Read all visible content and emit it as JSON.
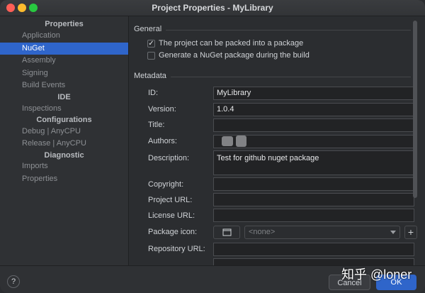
{
  "window": {
    "title": "Project Properties - MyLibrary"
  },
  "sidebar": {
    "sections": [
      {
        "heading": "Properties",
        "items": [
          "Application",
          "NuGet",
          "Assembly",
          "Signing",
          "Build Events"
        ]
      },
      {
        "heading": "IDE",
        "items": [
          "Inspections"
        ]
      },
      {
        "heading": "Configurations",
        "items": [
          "Debug | AnyCPU",
          "Release | AnyCPU"
        ]
      },
      {
        "heading": "Diagnostic",
        "items": [
          "Imports",
          "Properties"
        ]
      }
    ],
    "selected": "NuGet"
  },
  "general": {
    "title": "General",
    "pack_label": "The project can be packed into a package",
    "pack_checked": true,
    "build_label": "Generate a NuGet package during the build",
    "build_checked": false
  },
  "metadata": {
    "title": "Metadata",
    "fields": {
      "id": {
        "label": "ID:",
        "value": "MyLibrary"
      },
      "version": {
        "label": "Version:",
        "value": "1.0.4"
      },
      "title": {
        "label": "Title:",
        "value": ""
      },
      "authors": {
        "label": "Authors:",
        "value": ""
      },
      "description": {
        "label": "Description:",
        "value": "Test for github nuget package"
      },
      "copyright": {
        "label": "Copyright:",
        "value": ""
      },
      "project_url": {
        "label": "Project URL:",
        "value": ""
      },
      "license_url": {
        "label": "License URL:",
        "value": ""
      },
      "package_icon": {
        "label": "Package icon:",
        "value": "<none>"
      },
      "repository_url": {
        "label": "Repository URL:",
        "value": ""
      }
    }
  },
  "footer": {
    "help": "?",
    "cancel": "Cancel",
    "ok": "OK"
  },
  "watermark": "知乎 @loner",
  "icons": {
    "checkbox": "checkmark-icon",
    "browse": "folder-icon",
    "dropdown": "chevron-down-icon",
    "add": "plus-icon"
  }
}
